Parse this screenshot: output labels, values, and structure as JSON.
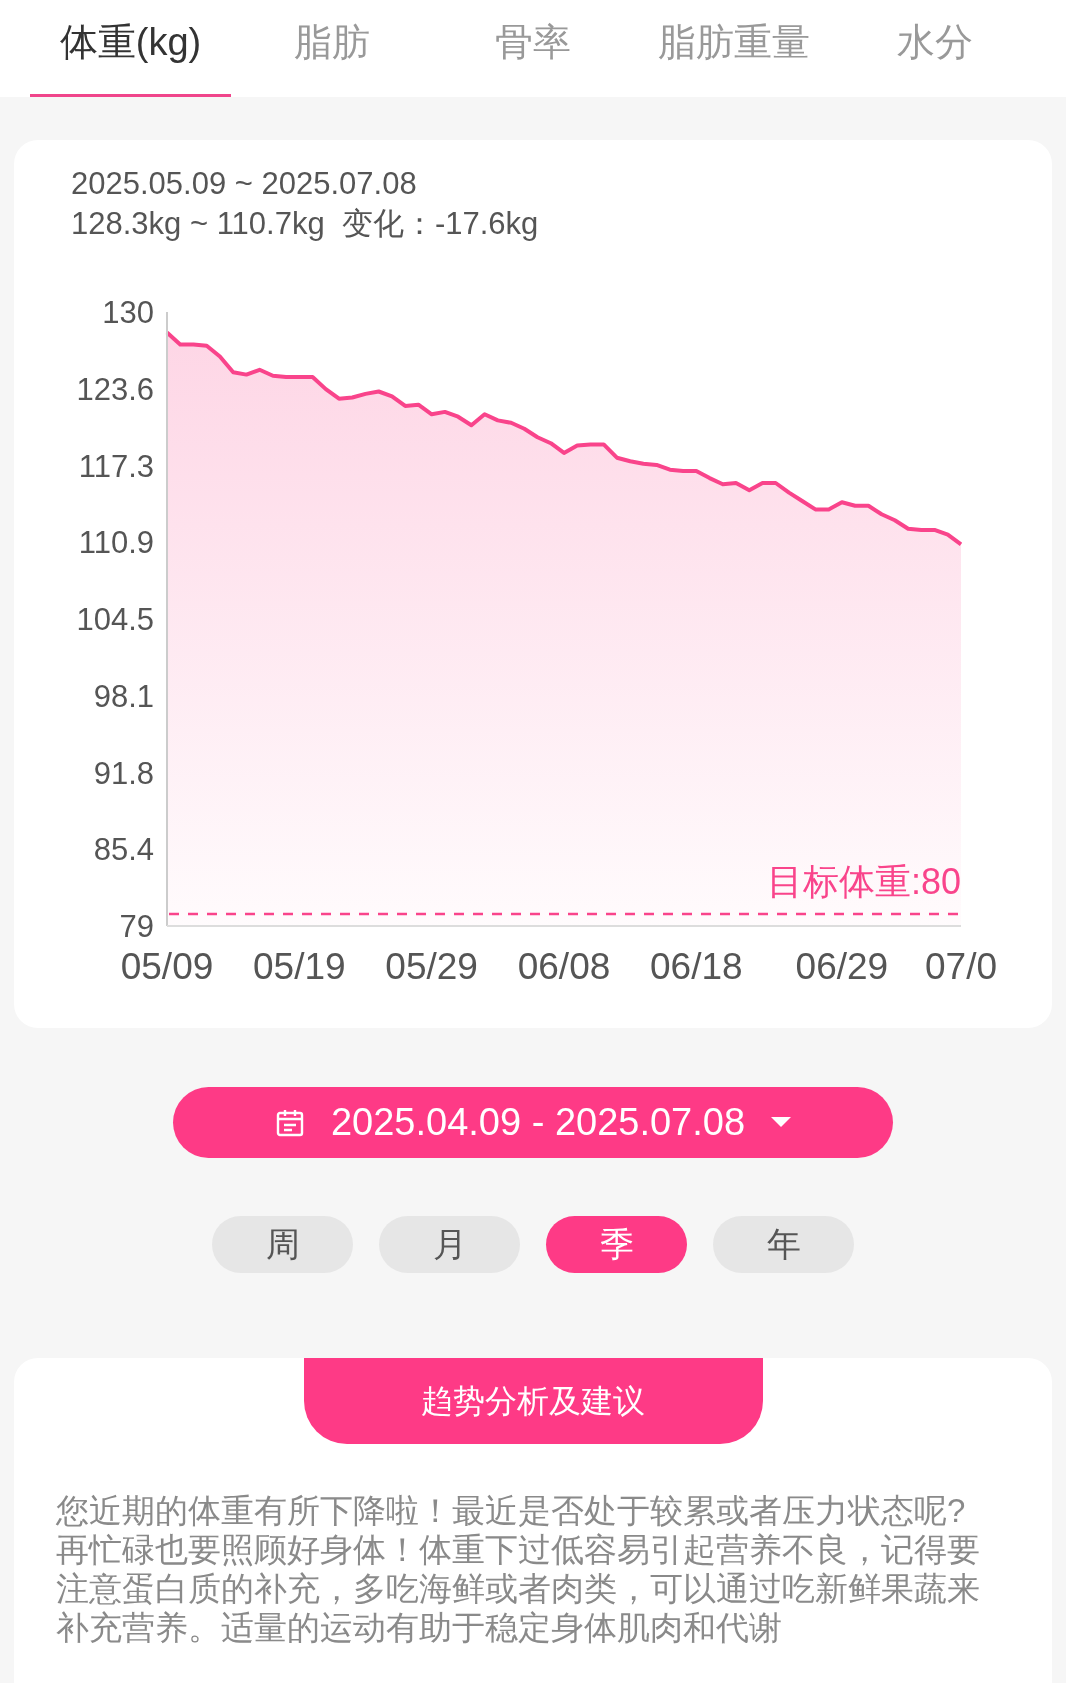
{
  "tabs": [
    {
      "label": "体重(kg)",
      "selected": true
    },
    {
      "label": "脂肪",
      "selected": false
    },
    {
      "label": "骨率",
      "selected": false
    },
    {
      "label": "脂肪重量",
      "selected": false
    },
    {
      "label": "水分",
      "selected": false
    }
  ],
  "summary_card": {
    "date_range": "2025.05.09 ~ 2025.07.08",
    "change": "128.3kg ~ 110.7kg  变化：-17.6kg",
    "chart_data": {
      "type": "area",
      "ylim": [
        79,
        130
      ],
      "categories": [
        "05/09",
        null,
        null,
        null,
        null,
        null,
        null,
        null,
        null,
        null,
        "05/19",
        null,
        null,
        null,
        null,
        null,
        null,
        null,
        null,
        null,
        "05/29",
        null,
        null,
        null,
        null,
        null,
        null,
        null,
        null,
        null,
        "06/08",
        null,
        null,
        null,
        null,
        null,
        null,
        null,
        null,
        null,
        "06/18",
        null,
        null,
        null,
        null,
        null,
        null,
        null,
        null,
        null,
        null,
        "06/29",
        null,
        null,
        null,
        null,
        null,
        null,
        null,
        null,
        "07/0"
      ],
      "yticks": [
        {
          "value": 130,
          "label": "130"
        },
        {
          "value": 123.625,
          "label": "123.6"
        },
        {
          "value": 117.25,
          "label": "117.3"
        },
        {
          "value": 110.875,
          "label": "110.9"
        },
        {
          "value": 104.5,
          "label": "104.5"
        },
        {
          "value": 98.125,
          "label": "98.1"
        },
        {
          "value": 91.75,
          "label": "91.8"
        },
        {
          "value": 85.375,
          "label": "85.4"
        },
        {
          "value": 79,
          "label": "79"
        }
      ],
      "series": [
        {
          "color": "#f9448b",
          "values": [
            128.3,
            127.3,
            127.3,
            127.2,
            126.3,
            125.0,
            124.8,
            125.2,
            124.7,
            124.6,
            124.6,
            124.6,
            123.6,
            122.8,
            122.9,
            123.2,
            123.4,
            123.0,
            122.2,
            122.3,
            121.5,
            121.7,
            121.3,
            120.6,
            121.5,
            121.0,
            120.8,
            120.3,
            119.6,
            119.1,
            118.3,
            118.9,
            119.0,
            119.0,
            117.9,
            117.6,
            117.4,
            117.3,
            116.9,
            116.8,
            116.8,
            116.2,
            115.7,
            115.8,
            115.2,
            115.8,
            115.8,
            115.0,
            114.3,
            113.6,
            113.6,
            114.2,
            113.9,
            113.9,
            113.2,
            112.7,
            112.0,
            111.9,
            111.9,
            111.5,
            110.7
          ]
        }
      ]
    },
    "goal_line": {
      "label": "目标体重:80"
    }
  },
  "date_picker": {
    "label": "2025.04.09 - 2025.07.08"
  },
  "periods": [
    {
      "label": "周",
      "selected": false
    },
    {
      "label": "月",
      "selected": false
    },
    {
      "label": "季",
      "selected": true
    },
    {
      "label": "年",
      "selected": false
    }
  ],
  "advice": {
    "title": "趋势分析及建议",
    "text": "您近期的体重有所下降啦！最近是否处于较累或者压力状态呢?再忙碌也要照顾好身体！体重下过低容易引起营养不良，记得要注意蛋白质的补充，多吃海鲜或者肉类，可以通过吃新鲜果蔬来补充营养。适量的运动有助于稳定身体肌肉和代谢"
  }
}
